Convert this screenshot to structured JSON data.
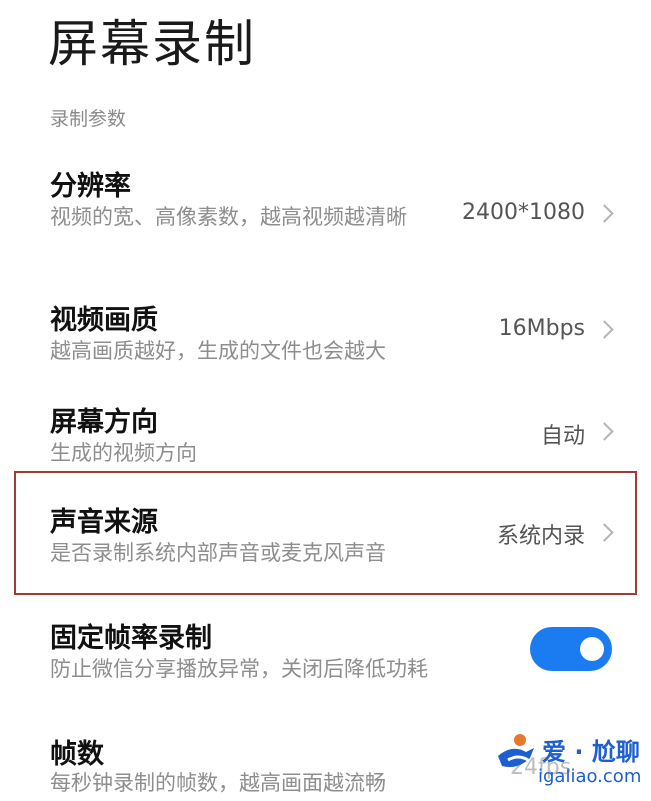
{
  "page_title": "屏幕录制",
  "section_label": "录制参数",
  "settings": [
    {
      "title": "分辨率",
      "desc": "视频的宽、高像素数，越高视频越清晰",
      "value": "2400*1080"
    },
    {
      "title": "视频画质",
      "desc": "越高画质越好，生成的文件也会越大",
      "value": "16Mbps"
    },
    {
      "title": "屏幕方向",
      "desc": "生成的视频方向",
      "value": "自动"
    },
    {
      "title": "声音来源",
      "desc": "是否录制系统内部声音或麦克风声音",
      "value": "系统内录"
    },
    {
      "title": "固定帧率录制",
      "desc": "防止微信分享播放异常，关闭后降低功耗",
      "toggle_on": true
    },
    {
      "title": "帧数",
      "desc": "每秒钟录制的帧数，越高画面越流畅",
      "value": "24fps"
    }
  ],
  "watermark": {
    "text": "爱 · 尬聊",
    "url": "igaliao.com"
  },
  "colors": {
    "accent": "#1a7cf0",
    "highlight_border": "#a33a3a"
  }
}
